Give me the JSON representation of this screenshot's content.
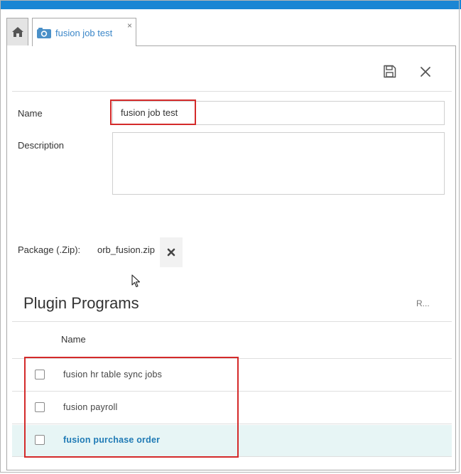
{
  "tab": {
    "title": "fusion job test",
    "close_glyph": "×",
    "icon": "camera-icon"
  },
  "toolbar": {
    "save_icon": "save-icon",
    "close_icon": "close-icon"
  },
  "form": {
    "name_label": "Name",
    "name_value": "fusion job test",
    "description_label": "Description",
    "description_value": "",
    "package_label": "Package (.Zip):",
    "package_file": "orb_fusion.zip"
  },
  "plugins": {
    "title": "Plugin Programs",
    "action_label": "R...",
    "column_name": "Name",
    "rows": [
      {
        "label": "fusion hr table sync jobs",
        "checked": false,
        "highlighted": false
      },
      {
        "label": "fusion payroll",
        "checked": false,
        "highlighted": false
      },
      {
        "label": "fusion purchase order",
        "checked": false,
        "highlighted": true
      }
    ]
  },
  "colors": {
    "accent": "#1a86d4",
    "annotation": "#d42a2a",
    "row_highlight": "#e7f5f5",
    "link": "#1f7ab5"
  }
}
